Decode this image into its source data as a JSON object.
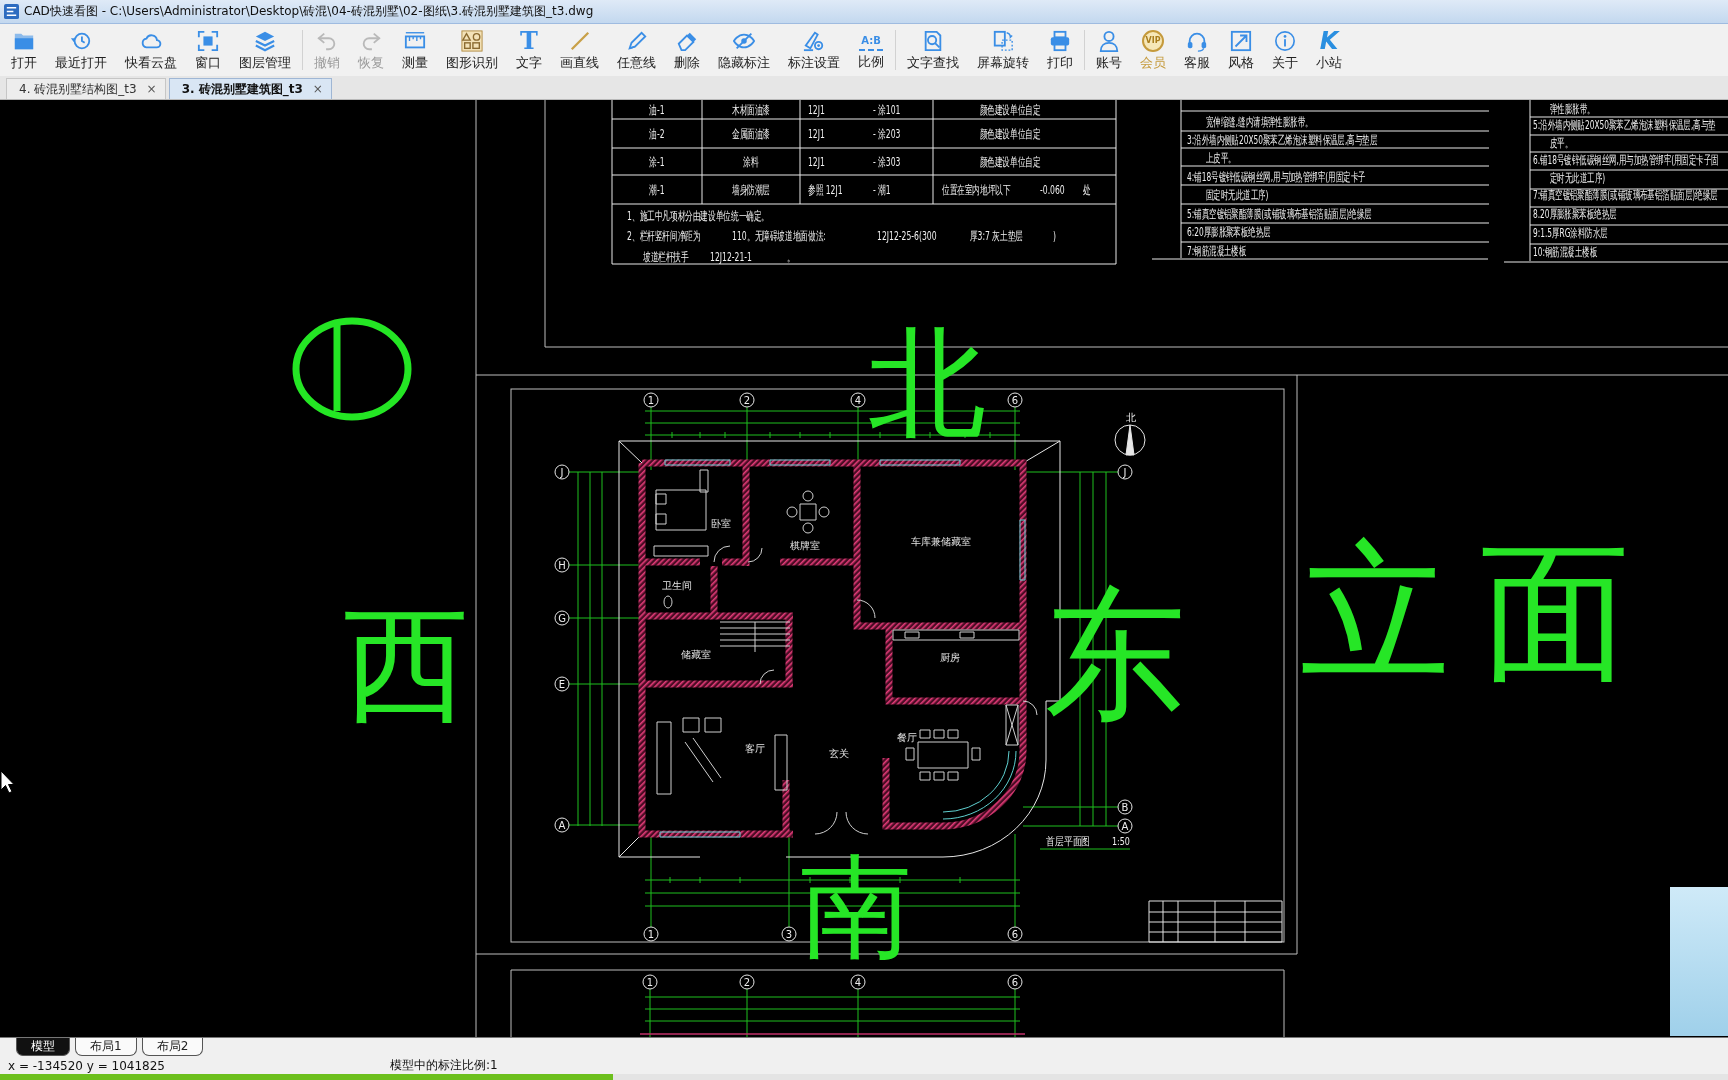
{
  "window": {
    "title": "CAD快速看图 - C:\\Users\\Administrator\\Desktop\\砖混\\04-砖混别墅\\02-图纸\\3.砖混别墅建筑图_t3.dwg"
  },
  "toolbar": {
    "groups": [
      [
        {
          "label": "打开",
          "kind": "tool",
          "disabled": false
        },
        {
          "label": "最近打开",
          "kind": "tool",
          "disabled": false
        },
        {
          "label": "快看云盘",
          "kind": "tool",
          "disabled": false
        },
        {
          "label": "窗口",
          "kind": "tool",
          "disabled": false
        },
        {
          "label": "图层管理",
          "kind": "tool",
          "disabled": false
        }
      ],
      [
        {
          "label": "撤销",
          "kind": "tool",
          "disabled": true
        },
        {
          "label": "恢复",
          "kind": "tool",
          "disabled": true
        },
        {
          "label": "测量",
          "kind": "tool",
          "disabled": false
        },
        {
          "label": "图形识别",
          "kind": "tool",
          "disabled": false
        },
        {
          "label": "文字",
          "kind": "tool",
          "disabled": false,
          "glyph": "T"
        },
        {
          "label": "画直线",
          "kind": "tool",
          "disabled": false
        },
        {
          "label": "任意线",
          "kind": "tool",
          "disabled": false
        },
        {
          "label": "删除",
          "kind": "tool",
          "disabled": false
        },
        {
          "label": "隐藏标注",
          "kind": "tool",
          "disabled": false
        },
        {
          "label": "标注设置",
          "kind": "tool",
          "disabled": false
        },
        {
          "label": "比例",
          "kind": "tool",
          "disabled": false,
          "glyph": "A:B"
        }
      ],
      [
        {
          "label": "文字查找",
          "kind": "tool",
          "disabled": false
        },
        {
          "label": "屏幕旋转",
          "kind": "tool",
          "disabled": false
        },
        {
          "label": "打印",
          "kind": "tool",
          "disabled": false
        }
      ],
      [
        {
          "label": "账号",
          "kind": "tool",
          "disabled": false
        },
        {
          "label": "会员",
          "kind": "vip",
          "disabled": false,
          "glyph": "VIP"
        },
        {
          "label": "客服",
          "kind": "tool",
          "disabled": false
        },
        {
          "label": "风格",
          "kind": "tool",
          "disabled": false
        },
        {
          "label": "关于",
          "kind": "tool",
          "disabled": false
        },
        {
          "label": "小站",
          "kind": "tool",
          "disabled": false,
          "glyph": "K"
        }
      ]
    ]
  },
  "tabs": [
    {
      "label": "4. 砖混别墅结构图_t3",
      "close": "×",
      "selected": false
    },
    {
      "label": "3. 砖混别墅建筑图_t3",
      "close": "×",
      "selected": true
    }
  ],
  "drawing": {
    "material_table": {
      "rows": [
        [
          "油-1",
          "木材面油漆",
          [
            "12J1",
            "- 涂101"
          ],
          "颜色建设单位自定"
        ],
        [
          "油-2",
          "金属面油漆",
          [
            "12J1",
            "- 涂203"
          ],
          "颜色建设单位自定"
        ],
        [
          "涂-1",
          "涂料",
          [
            "12J1",
            "- 涂303"
          ],
          "颜色建设单位自定"
        ],
        [
          "潮-1",
          "墙身防潮层",
          [
            "参照 12J1",
            "- 潮1"
          ],
          [
            "位置在室内地坪以下",
            "-0.060",
            "处"
          ]
        ]
      ],
      "notes": [
        [
          "1、施工中凡项材分由建设单位统一确定。"
        ],
        [
          "2、栏杆竖杆间净距为",
          "110",
          "。无障碍坡道地面做法:",
          "12J12-25-6(300",
          "厚3:7 灰土垫层",
          ")"
        ],
        [
          "坡道栏杆扶手",
          "12J12-21-1",
          "。"
        ]
      ]
    },
    "spec_notes": {
      "columns": [
        [
          {
            "text": "宽伸缩缝,缝内请填弹性膨胀带。",
            "kind": "continuation"
          },
          {
            "text": "3:沿外墙内侧贴20X50聚苯乙烯泡沫塑料保温层,高与垫层",
            "kind": "item"
          },
          {
            "text": "上皮平。",
            "kind": "continuation"
          },
          {
            "text": "4:铺18号镀锌低碳钢丝网,用与加热管绑牢(用固定卡子",
            "kind": "item"
          },
          {
            "text": "固定时无此道工序)",
            "kind": "continuation"
          },
          {
            "text": "5:铺真空镀铝聚酯薄膜(或铺玻璃布基铝箔贴面层)绝缘层",
            "kind": "item"
          },
          {
            "text": "6:20厚膨胀聚苯板绝热层",
            "kind": "item"
          },
          {
            "text": "7:钢筋混凝土楼板",
            "kind": "item"
          }
        ],
        [
          {
            "text": "弹性膨胀带。",
            "kind": "continuation"
          },
          {
            "text": "5:沿外墙内侧贴20X50聚苯乙烯泡沫塑料保温层,高与垫",
            "kind": "item"
          },
          {
            "text": "皮平。",
            "kind": "continuation"
          },
          {
            "text": "6.铺18号镀锌低碳钢丝网,用与加热管绑牢(用固定卡子固",
            "kind": "item"
          },
          {
            "text": "定时无此道工序)",
            "kind": "continuation"
          },
          {
            "text": "7:铺真空镀铝聚酯薄膜(或铺玻璃布基铝箔贴面层)绝缘层",
            "kind": "item"
          },
          {
            "text": "8.20厚膨胀聚苯板绝热层",
            "kind": "item"
          },
          {
            "text": "9:1.5厚RG涂料防水层",
            "kind": "item"
          },
          {
            "text": "10:钢筋混凝土楼板",
            "kind": "item"
          }
        ]
      ]
    },
    "floor_plan": {
      "top_axes": [
        "1",
        "2",
        "4",
        "6"
      ],
      "bottom_axes": [
        "1",
        "3",
        "6"
      ],
      "left_axes": [
        "J",
        "H",
        "G",
        "E",
        "A"
      ],
      "right_axes": [
        "J",
        "B",
        "A"
      ],
      "north_label": "北",
      "rooms": [
        "卧室",
        "棋牌室",
        "车库兼储藏室",
        "卫生间",
        "储藏室",
        "厨房",
        "餐厅",
        "客厅",
        "玄关"
      ],
      "title": "首层平面图",
      "scale": "1:50"
    },
    "next_plan": {
      "top_axes": [
        "1",
        "2",
        "4",
        "6"
      ]
    }
  },
  "annotations": [
    {
      "kind": "circle"
    },
    {
      "kind": "text",
      "text": "北"
    },
    {
      "kind": "text",
      "text": "西"
    },
    {
      "kind": "text",
      "text": "东"
    },
    {
      "kind": "text",
      "text": "立面"
    },
    {
      "kind": "text",
      "text": "南"
    }
  ],
  "layout_tabs": [
    {
      "label": "模型",
      "selected": true
    },
    {
      "label": "布局1",
      "selected": false
    },
    {
      "label": "布局2",
      "selected": false
    }
  ],
  "status_bar": {
    "coordinates": "x = -134520 y = 1041825",
    "scale": "模型中的标注比例:1"
  },
  "video_progress": {
    "level": 0.355
  },
  "webcam_overlay": {
    "shown": true
  }
}
